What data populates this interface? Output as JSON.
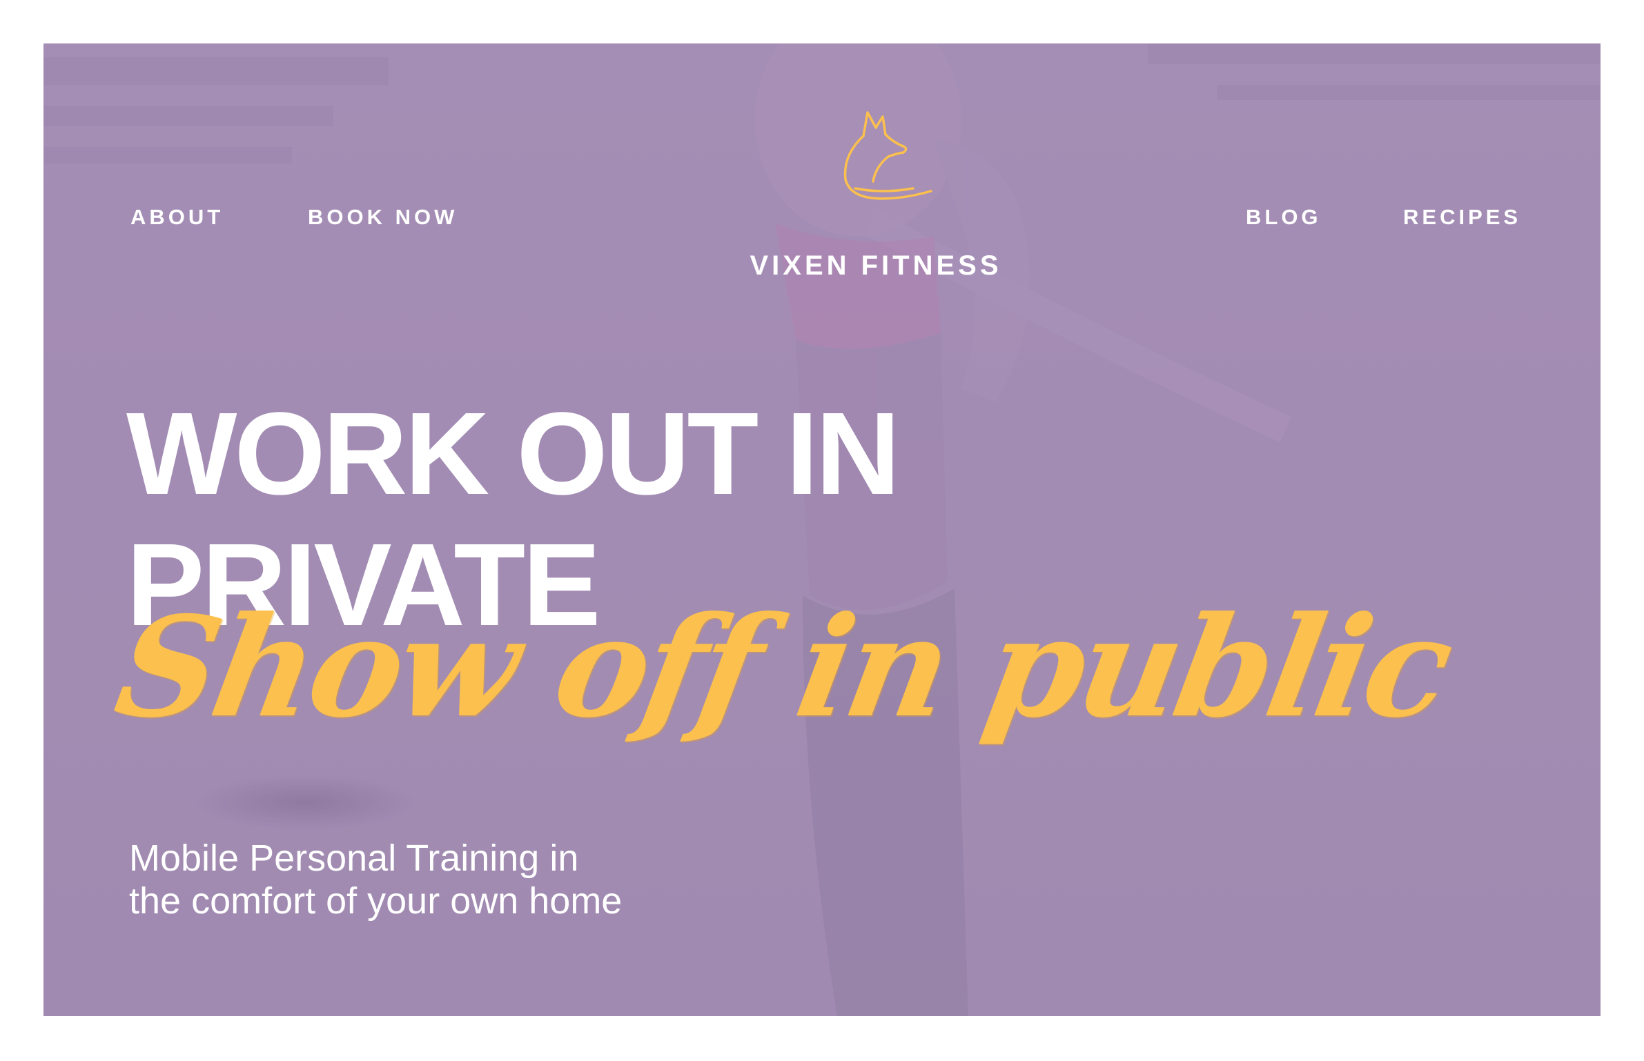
{
  "nav": {
    "left": [
      {
        "label": "ABOUT"
      },
      {
        "label": "BOOK NOW"
      }
    ],
    "right": [
      {
        "label": "BLOG"
      },
      {
        "label": "RECIPES"
      }
    ]
  },
  "brand": {
    "name": "VIXEN FITNESS",
    "logo_icon": "fox-icon"
  },
  "hero": {
    "headline_lines": [
      "WORK OUT IN",
      "PRIVATE"
    ],
    "script_tagline": "Show off in public",
    "subtext_lines": [
      "Mobile Personal Training in",
      "the comfort of your own home"
    ]
  },
  "colors": {
    "overlay": "#a28db3",
    "accent": "#fbc04d",
    "text": "#ffffff"
  }
}
